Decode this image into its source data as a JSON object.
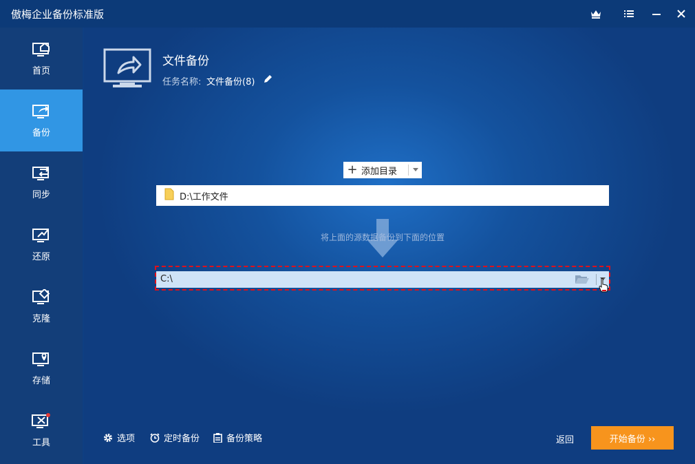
{
  "window": {
    "title": "傲梅企业备份标准版"
  },
  "sidebar": {
    "items": [
      {
        "label": "首页",
        "icon": "home-icon"
      },
      {
        "label": "备份",
        "icon": "backup-icon"
      },
      {
        "label": "同步",
        "icon": "sync-icon"
      },
      {
        "label": "还原",
        "icon": "restore-icon"
      },
      {
        "label": "克隆",
        "icon": "clone-icon"
      },
      {
        "label": "存储",
        "icon": "storage-icon"
      },
      {
        "label": "工具",
        "icon": "tools-icon"
      }
    ]
  },
  "header": {
    "title": "文件备份",
    "task_label": "任务名称:",
    "task_value": "文件备份(8)"
  },
  "source": {
    "add_button": "添加目录",
    "path": "D:\\工作文件"
  },
  "hint": "将上面的源数据备份到下面的位置",
  "destination": {
    "path": "C:\\"
  },
  "footer": {
    "options": "选项",
    "schedule": "定时备份",
    "scheme": "备份策略",
    "back": "返回",
    "start": "开始备份 ››"
  },
  "colors": {
    "accent": "#3196e4",
    "start_button": "#f7941d",
    "highlight": "#e0101a"
  }
}
